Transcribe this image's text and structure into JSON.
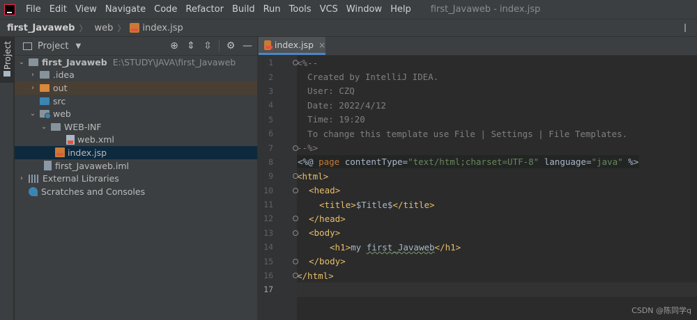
{
  "menubar": {
    "items": [
      "File",
      "Edit",
      "View",
      "Navigate",
      "Code",
      "Refactor",
      "Build",
      "Run",
      "Tools",
      "VCS",
      "Window",
      "Help"
    ],
    "underline": [
      "F",
      "E",
      "V",
      "N",
      "C",
      "R",
      "B",
      "u",
      "T",
      "S",
      "W",
      "H"
    ],
    "window_title": "first_Javaweb - index.jsp"
  },
  "breadcrumb": {
    "project": "first_Javaweb",
    "folder": "web",
    "file": "index.jsp"
  },
  "sidebar": {
    "project_tab": "Project"
  },
  "project_panel": {
    "title": "Project",
    "tree": [
      {
        "label": "first_Javaweb",
        "path": "E:\\STUDY\\JAVA\\first_Javaweb"
      },
      {
        "label": ".idea"
      },
      {
        "label": "out"
      },
      {
        "label": "src"
      },
      {
        "label": "web"
      },
      {
        "label": "WEB-INF"
      },
      {
        "label": "web.xml"
      },
      {
        "label": "index.jsp"
      },
      {
        "label": "first_Javaweb.iml"
      },
      {
        "label": "External Libraries"
      },
      {
        "label": "Scratches and Consoles"
      }
    ]
  },
  "editor": {
    "tab_label": "index.jsp",
    "line_numbers": [
      "1",
      "2",
      "3",
      "4",
      "5",
      "6",
      "7",
      "8",
      "9",
      "10",
      "11",
      "12",
      "13",
      "14",
      "15",
      "16",
      "17"
    ],
    "code": {
      "l1": "<%--",
      "l2": "  Created by IntelliJ IDEA.",
      "l3": "  User: CZQ",
      "l4": "  Date: 2022/4/12",
      "l5": "  Time: 19:20",
      "l6": "  To change this template use File | Settings | File Templates.",
      "l7": "--%>",
      "l8_open": "<%@ ",
      "l8_page": "page",
      "l8_ct": " contentType=",
      "l8_ctv": "\"text/html;charset=UTF-8\"",
      "l8_lang": " language=",
      "l8_langv": "\"java\"",
      "l8_close": " %>",
      "l9": "<html>",
      "l10": "<head>",
      "l11_open": "<title>",
      "l11_text": "$Title$",
      "l11_close": "</title>",
      "l12": "</head>",
      "l13": "<body>",
      "l14_open": "<h1>",
      "l14_text1": "my ",
      "l14_text2": "first_Javaweb",
      "l14_close": "</h1>",
      "l15": "</body>",
      "l16": "</html>"
    }
  },
  "watermark": "CSDN @陈同学q"
}
